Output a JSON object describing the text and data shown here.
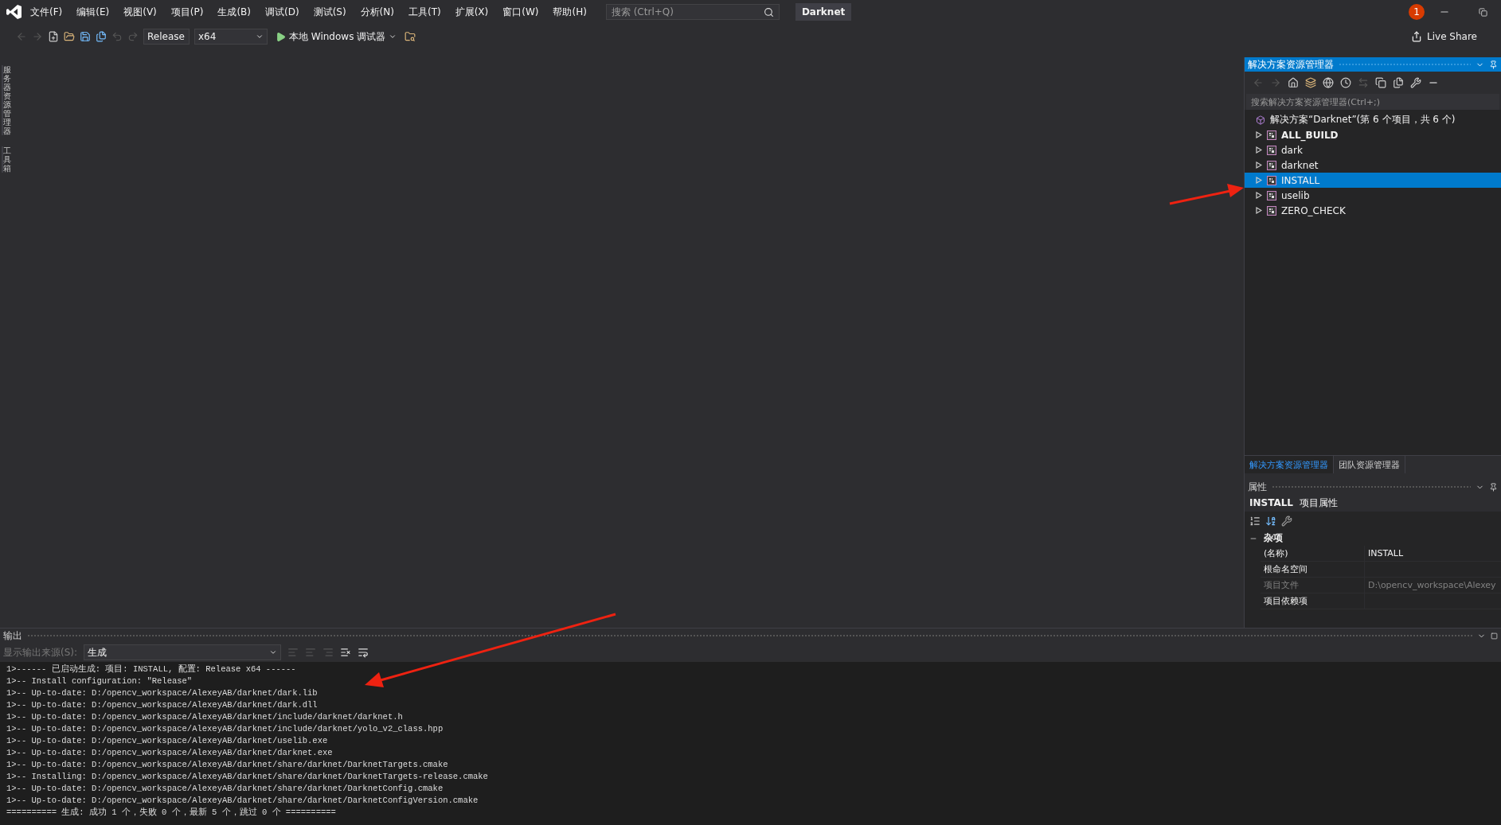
{
  "menu": [
    "文件(F)",
    "编辑(E)",
    "视图(V)",
    "项目(P)",
    "生成(B)",
    "调试(D)",
    "测试(S)",
    "分析(N)",
    "工具(T)",
    "扩展(X)",
    "窗口(W)",
    "帮助(H)"
  ],
  "search": {
    "placeholder": "搜索 (Ctrl+Q)"
  },
  "window": {
    "title": "Darknet",
    "notification_count": "1"
  },
  "toolbar": {
    "configuration": "Release",
    "platform": "x64",
    "debug_target": "本地 Windows 调试器",
    "live_share": "Live Share"
  },
  "left_rail": [
    "服务器资源管理器",
    "工具箱"
  ],
  "solution_explorer": {
    "title": "解决方案资源管理器",
    "search_placeholder": "搜索解决方案资源管理器(Ctrl+;)",
    "solution": "解决方案“Darknet”(第 6 个项目，共 6 个)",
    "projects": [
      {
        "name": "ALL_BUILD",
        "startup": true,
        "selected": false
      },
      {
        "name": "dark",
        "startup": false,
        "selected": false
      },
      {
        "name": "darknet",
        "startup": false,
        "selected": false
      },
      {
        "name": "INSTALL",
        "startup": false,
        "selected": true
      },
      {
        "name": "uselib",
        "startup": false,
        "selected": false
      },
      {
        "name": "ZERO_CHECK",
        "startup": false,
        "selected": false
      }
    ]
  },
  "bottom_tabs": [
    {
      "label": "解决方案资源管理器",
      "selected": true
    },
    {
      "label": "团队资源管理器",
      "selected": false
    }
  ],
  "properties": {
    "title": "属性",
    "object_name": "INSTALL",
    "object_type": "项目属性",
    "category": {
      "label": "杂项",
      "expanded": true
    },
    "rows": [
      {
        "name": "(名称)",
        "value": "INSTALL",
        "disabled": false
      },
      {
        "name": "根命名空间",
        "value": "",
        "disabled": false
      },
      {
        "name": "项目文件",
        "value": "D:\\opencv_workspace\\Alexey",
        "disabled": true
      },
      {
        "name": "项目依赖项",
        "value": "",
        "disabled": false
      }
    ]
  },
  "output": {
    "title": "输出",
    "source_label": "显示输出来源(S):",
    "source": "生成",
    "lines": [
      "1>------ 已启动生成: 项目: INSTALL, 配置: Release x64 ------",
      "1>-- Install configuration: \"Release\"",
      "1>-- Up-to-date: D:/opencv_workspace/AlexeyAB/darknet/dark.lib",
      "1>-- Up-to-date: D:/opencv_workspace/AlexeyAB/darknet/dark.dll",
      "1>-- Up-to-date: D:/opencv_workspace/AlexeyAB/darknet/include/darknet/darknet.h",
      "1>-- Up-to-date: D:/opencv_workspace/AlexeyAB/darknet/include/darknet/yolo_v2_class.hpp",
      "1>-- Up-to-date: D:/opencv_workspace/AlexeyAB/darknet/uselib.exe",
      "1>-- Up-to-date: D:/opencv_workspace/AlexeyAB/darknet/darknet.exe",
      "1>-- Up-to-date: D:/opencv_workspace/AlexeyAB/darknet/share/darknet/DarknetTargets.cmake",
      "1>-- Installing: D:/opencv_workspace/AlexeyAB/darknet/share/darknet/DarknetTargets-release.cmake",
      "1>-- Up-to-date: D:/opencv_workspace/AlexeyAB/darknet/share/darknet/DarknetConfig.cmake",
      "1>-- Up-to-date: D:/opencv_workspace/AlexeyAB/darknet/share/darknet/DarknetConfigVersion.cmake",
      "========== 生成: 成功 1 个，失败 0 个，最新 5 个，跳过 0 个 =========="
    ]
  }
}
